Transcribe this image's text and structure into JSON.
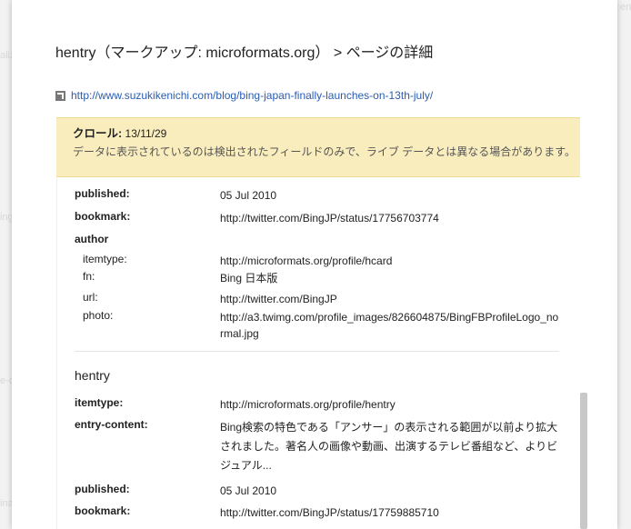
{
  "background": {
    "fragments": [
      "ent",
      "aliz",
      "ing",
      "e-o",
      "inal"
    ]
  },
  "dialog": {
    "title": "hentry（マークアップ: microformats.org） > ページの詳細",
    "url": "http://www.suzukikenichi.com/blog/bing-japan-finally-launches-on-13th-july/",
    "notice": {
      "crawl_label": "クロール:",
      "crawl_date": "13/11/29",
      "text": "データに表示されているのは検出されたフィールドのみで、ライブ データとは異なる場合があります。"
    },
    "items": {
      "published_label": "published:",
      "published_value": "05 Jul 2010",
      "bookmark_label": "bookmark:",
      "bookmark_value": "http://twitter.com/BingJP/status/17756703774",
      "author_label": "author",
      "author": {
        "itemtype_label": "itemtype:",
        "itemtype_value": "http://microformats.org/profile/hcard",
        "fn_label": "fn:",
        "fn_value": "Bing 日本版",
        "url_label": "url:",
        "url_value": "http://twitter.com/BingJP",
        "photo_label": "photo:",
        "photo_value": "http://a3.twimg.com/profile_images/826604875/BingFBProfileLogo_normal.jpg"
      }
    },
    "hentry": {
      "heading": "hentry",
      "itemtype_label": "itemtype:",
      "itemtype_value": "http://microformats.org/profile/hentry",
      "entry_content_label": "entry-content:",
      "entry_content_value": "Bing検索の特色である「アンサー」の表示される範囲が以前より拡大されました。著名人の画像や動画、出演するテレビ番組など、よりビジュアル...",
      "published_label": "published:",
      "published_value": "05 Jul 2010",
      "bookmark_label": "bookmark:",
      "bookmark_value": "http://twitter.com/BingJP/status/17759885710"
    }
  }
}
